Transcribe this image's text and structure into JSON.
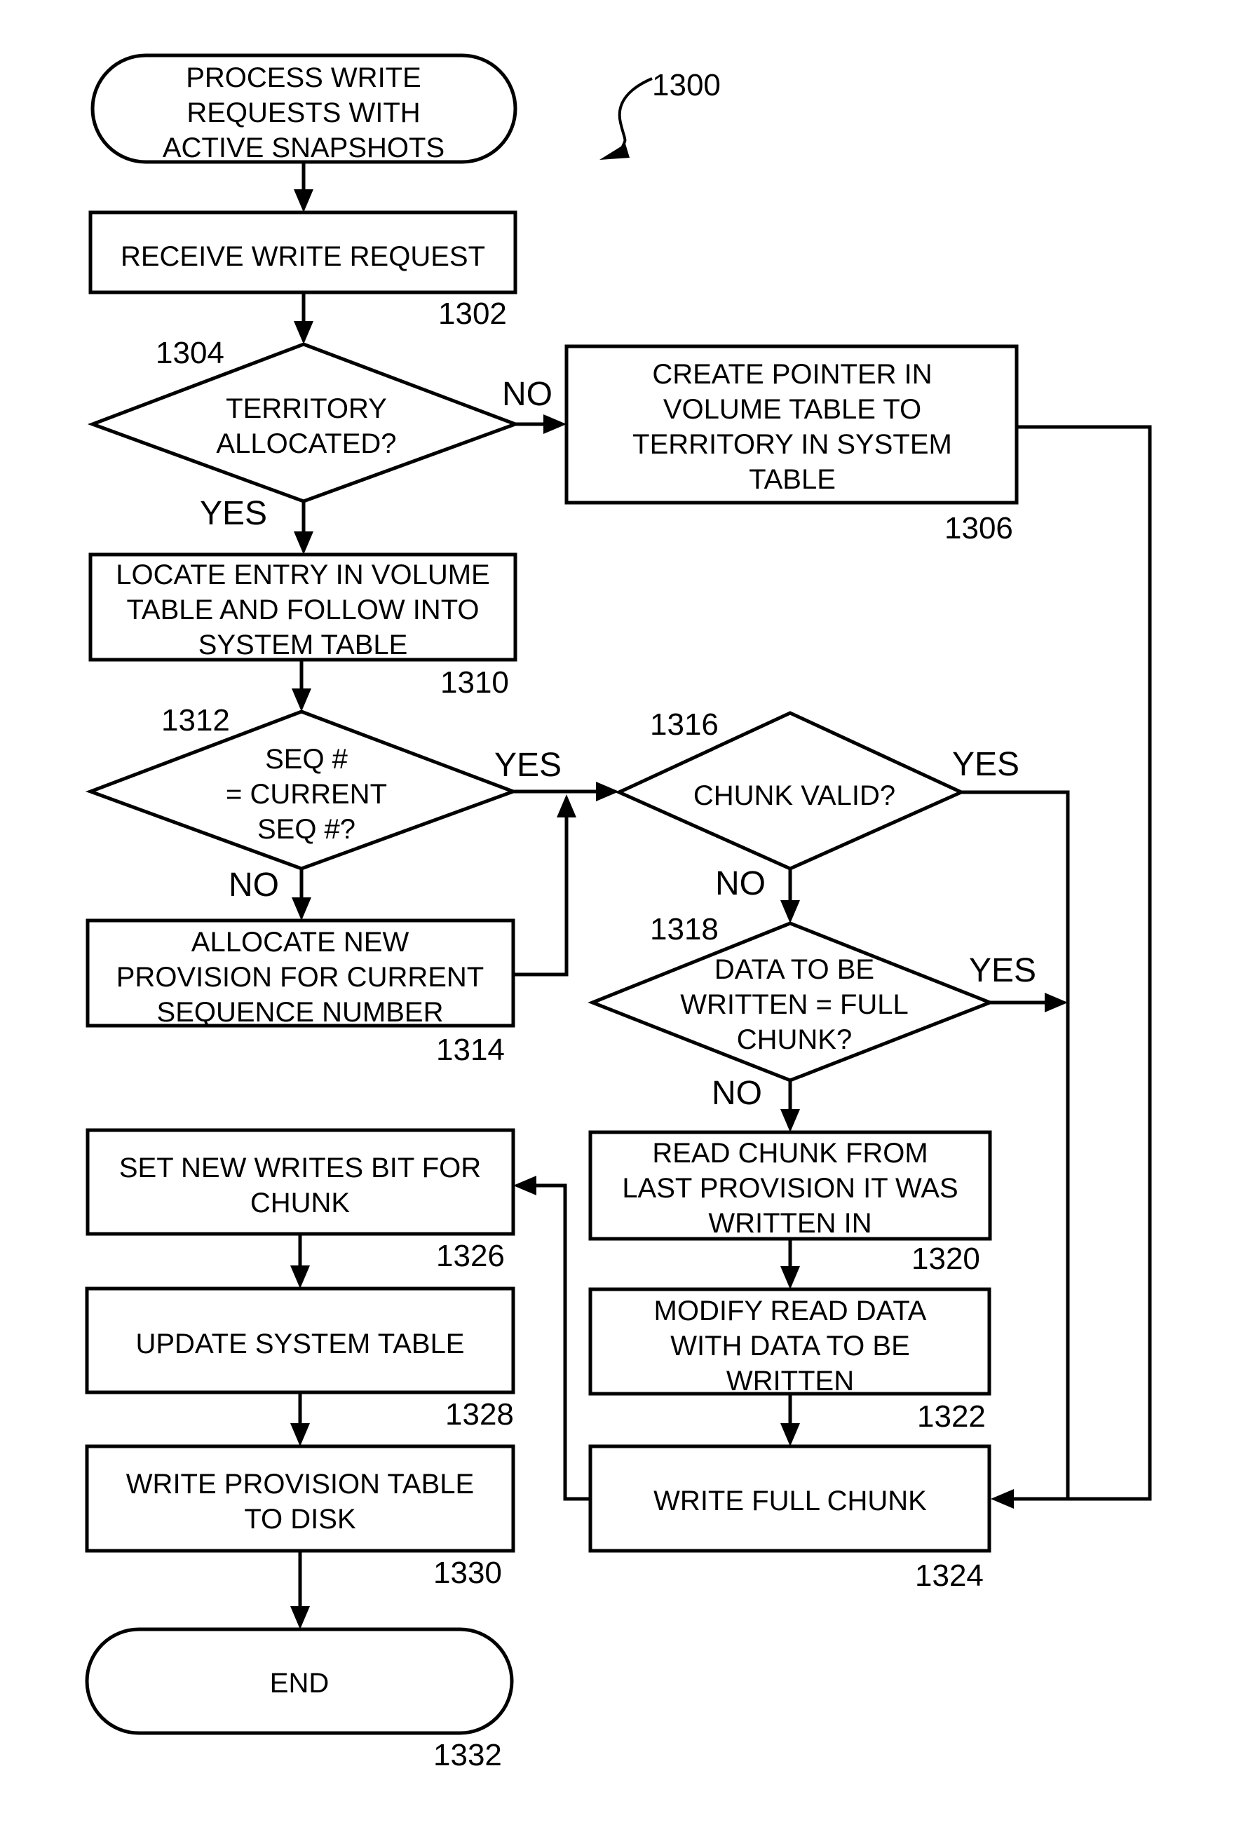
{
  "figure_ref": "1300",
  "nodes": {
    "start": {
      "ref": "",
      "lines": [
        "PROCESS WRITE",
        "REQUESTS WITH",
        "ACTIVE SNAPSHOTS"
      ]
    },
    "n1302": {
      "ref": "1302",
      "lines": [
        "RECEIVE WRITE REQUEST"
      ]
    },
    "n1304": {
      "ref": "1304",
      "lines": [
        "TERRITORY",
        "ALLOCATED?"
      ]
    },
    "n1306": {
      "ref": "1306",
      "lines": [
        "CREATE POINTER IN",
        "VOLUME TABLE TO",
        "TERRITORY IN SYSTEM",
        "TABLE"
      ]
    },
    "n1310": {
      "ref": "1310",
      "lines": [
        "LOCATE ENTRY IN VOLUME",
        "TABLE AND FOLLOW INTO",
        "SYSTEM TABLE"
      ]
    },
    "n1312": {
      "ref": "1312",
      "lines": [
        "SEQ #",
        "= CURRENT",
        "SEQ #?"
      ]
    },
    "n1314": {
      "ref": "1314",
      "lines": [
        "ALLOCATE NEW",
        "PROVISION FOR CURRENT",
        "SEQUENCE NUMBER"
      ]
    },
    "n1316": {
      "ref": "1316",
      "lines": [
        "CHUNK VALID?"
      ]
    },
    "n1318": {
      "ref": "1318",
      "lines": [
        "DATA TO BE",
        "WRITTEN = FULL",
        "CHUNK?"
      ]
    },
    "n1320": {
      "ref": "1320",
      "lines": [
        "READ CHUNK FROM",
        "LAST PROVISION IT WAS",
        "WRITTEN IN"
      ]
    },
    "n1322": {
      "ref": "1322",
      "lines": [
        "MODIFY READ DATA",
        "WITH DATA TO BE",
        "WRITTEN"
      ]
    },
    "n1324": {
      "ref": "1324",
      "lines": [
        "WRITE FULL CHUNK"
      ]
    },
    "n1326": {
      "ref": "1326",
      "lines": [
        "SET NEW WRITES BIT FOR",
        "CHUNK"
      ]
    },
    "n1328": {
      "ref": "1328",
      "lines": [
        "UPDATE SYSTEM TABLE"
      ]
    },
    "n1330": {
      "ref": "1330",
      "lines": [
        "WRITE PROVISION TABLE",
        "TO DISK"
      ]
    },
    "end": {
      "ref": "1332",
      "lines": [
        "END"
      ]
    }
  },
  "edge_labels": {
    "d1304_no": "NO",
    "d1304_yes": "YES",
    "d1312_yes": "YES",
    "d1312_no": "NO",
    "d1316_yes": "YES",
    "d1316_no": "NO",
    "d1318_yes": "YES",
    "d1318_no": "NO"
  }
}
